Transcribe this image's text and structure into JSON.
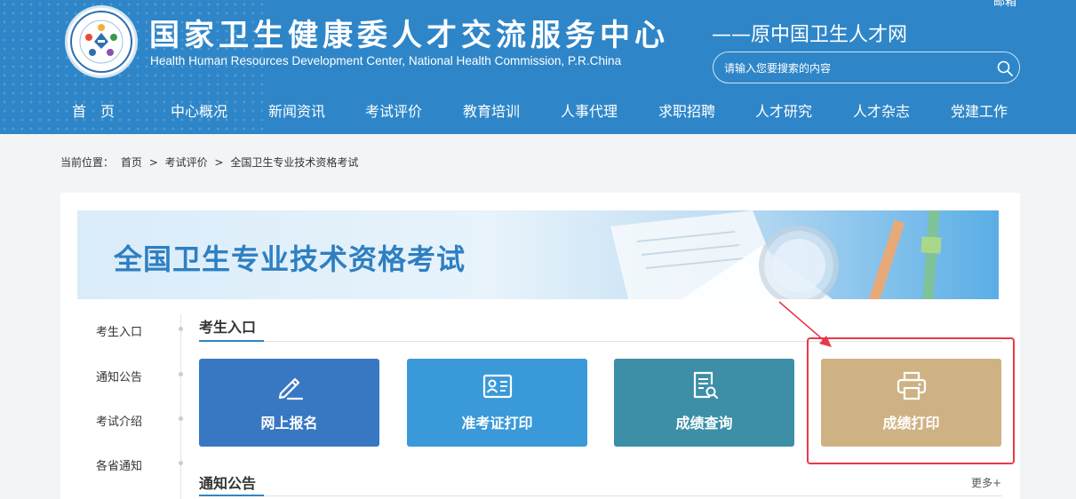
{
  "header": {
    "title_cn": "国家卫生健康委人才交流服务中心",
    "title_en": "Health Human Resources Development Center, National Health Commission, P.R.China",
    "subtitle": "——原中国卫生人才网",
    "mailbox_label": "邮箱",
    "search_placeholder": "请输入您要搜索的内容",
    "nav": [
      "首　页",
      "中心概况",
      "新闻资讯",
      "考试评价",
      "教育培训",
      "人事代理",
      "求职招聘",
      "人才研究",
      "人才杂志",
      "党建工作"
    ]
  },
  "breadcrumb": {
    "prefix": "当前位置：",
    "items": [
      "首页",
      ">",
      "考试评价",
      ">",
      "全国卫生专业技术资格考试"
    ]
  },
  "banner": {
    "title": "全国卫生专业技术资格考试"
  },
  "sidebar": {
    "items": [
      "考生入口",
      "通知公告",
      "考试介绍",
      "各省通知"
    ]
  },
  "sections": {
    "entrance_title": "考生入口",
    "notice_title": "通知公告",
    "more_label": "更多+"
  },
  "cards": [
    {
      "label": "网上报名",
      "icon": "pen-edit-icon",
      "color": "#3878c3"
    },
    {
      "label": "准考证打印",
      "icon": "id-card-icon",
      "color": "#3a9ad9"
    },
    {
      "label": "成绩查询",
      "icon": "document-search-icon",
      "color": "#3c8fa6"
    },
    {
      "label": "成绩打印",
      "icon": "printer-icon",
      "color": "#cfb284"
    }
  ],
  "colors": {
    "header_bg": "#2e86c8",
    "highlight": "#e8394a"
  }
}
